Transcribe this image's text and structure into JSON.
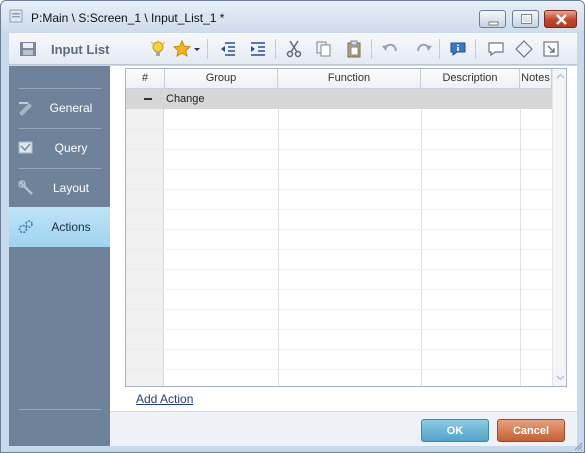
{
  "window": {
    "title": "P:Main \\ S:Screen_1 \\ Input_List_1 *"
  },
  "toolbar": {
    "title": "Input List",
    "icons": [
      "save-icon",
      "lightbulb-icon",
      "star-icon",
      "dropdown-arrow-icon",
      "outdent-icon",
      "indent-icon",
      "cut-icon",
      "copy-icon",
      "paste-icon",
      "undo-icon",
      "redo-icon",
      "info-comment-icon",
      "comment-icon",
      "tag-icon",
      "export-icon"
    ]
  },
  "sidebar": {
    "items": [
      {
        "label": "General",
        "icon": "general-icon",
        "active": false
      },
      {
        "label": "Query",
        "icon": "query-icon",
        "active": false
      },
      {
        "label": "Layout",
        "icon": "layout-icon",
        "active": false
      },
      {
        "label": "Actions",
        "icon": "actions-gear-icon",
        "active": true
      }
    ]
  },
  "grid": {
    "columns": [
      "#",
      "Group",
      "Function",
      "Description",
      "Notes"
    ],
    "groups": [
      {
        "label": "Change",
        "expanded": true
      }
    ],
    "rows": []
  },
  "actions": {
    "add_action_label": "Add Action"
  },
  "buttons": {
    "ok_label": "OK",
    "cancel_label": "Cancel"
  },
  "colors": {
    "sidebar_bg": "#6e8399",
    "sidebar_active": "#a8d8f0",
    "ok_button": "#4fa3c7",
    "cancel_button": "#c45f34"
  }
}
